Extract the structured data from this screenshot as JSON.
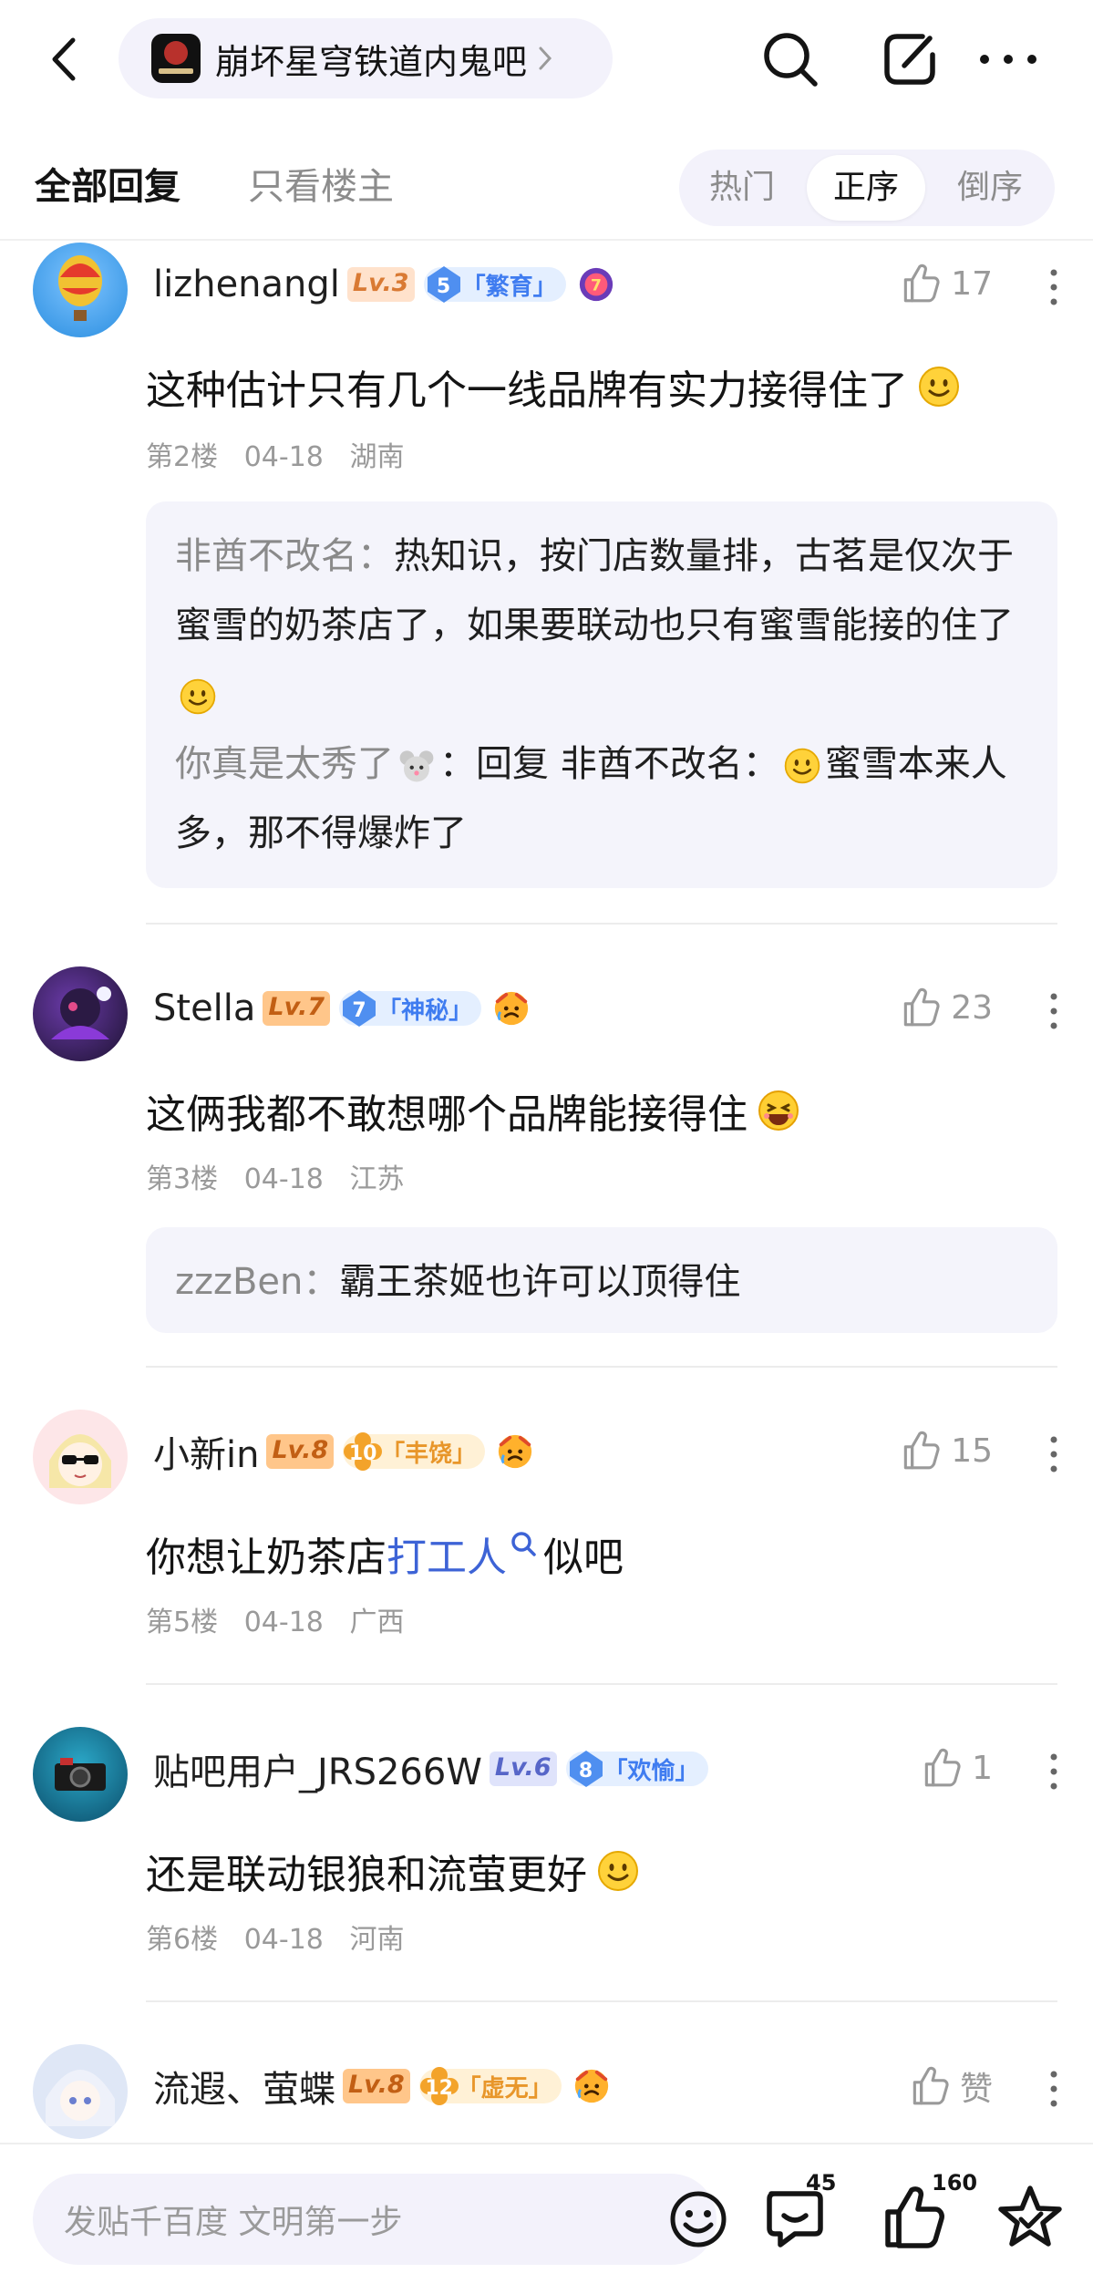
{
  "header": {
    "forum_name": "崩坏星穹铁道内鬼吧"
  },
  "tabs": {
    "all": "全部回复",
    "op_only": "只看楼主",
    "sort": {
      "hot": "热门",
      "asc": "正序",
      "desc": "倒序",
      "selected": "正序"
    }
  },
  "posts": [
    {
      "username": "lizhenangl",
      "level": "Lv.3",
      "tier_num": "5",
      "tier_label": "「繁育」",
      "likes": "17",
      "content": "这种估计只有几个一线品牌有实力接得住了",
      "floor": "第2楼",
      "date": "04-18",
      "location": "湖南",
      "replies": [
        {
          "name": "非酋不改名：",
          "text": "热知识，按门店数量排，古茗是仅次于蜜雪的奶茶店了，如果要联动也只有蜜雪能接的住了"
        },
        {
          "name": "你真是太秀了",
          "text_prefix": "：回复 非酋不改名：",
          "text": "蜜雪本来人多，那不得爆炸了"
        }
      ]
    },
    {
      "username": "Stella",
      "level": "Lv.7",
      "tier_num": "7",
      "tier_label": "「神秘」",
      "likes": "23",
      "content": "这俩我都不敢想哪个品牌能接得住",
      "floor": "第3楼",
      "date": "04-18",
      "location": "江苏",
      "replies": [
        {
          "name": "zzzBen：",
          "text": "霸王茶姬也许可以顶得住"
        }
      ]
    },
    {
      "username": "小新in",
      "level": "Lv.8",
      "tier_num": "10",
      "tier_label": "「丰饶」",
      "likes": "15",
      "content_before": "你想让奶茶店",
      "content_link": "打工人",
      "content_after": "似吧",
      "floor": "第5楼",
      "date": "04-18",
      "location": "广西"
    },
    {
      "username": "贴吧用户_JRS266W",
      "level": "Lv.6",
      "tier_num": "8",
      "tier_label": "「欢愉」",
      "likes": "1",
      "content": "还是联动银狼和流萤更好",
      "floor": "第6楼",
      "date": "04-18",
      "location": "河南"
    },
    {
      "username": "流遐、萤蝶",
      "level": "Lv.8",
      "tier_num": "12",
      "tier_label": "「虚无」",
      "likes": "赞"
    }
  ],
  "bottom": {
    "input_placeholder": "发贴千百度 文明第一步",
    "comment_count": "45",
    "like_count": "160"
  },
  "icons": {
    "back": "back-arrow-icon",
    "search": "search-icon",
    "share": "share-icon",
    "more": "more-icon",
    "like": "thumbs-up-icon",
    "emoji": "smiley-icon",
    "comment": "comment-icon",
    "favorite": "star-icon"
  },
  "colors": {
    "accent_link": "#3d63d6",
    "pill_bg": "#f3f2fb",
    "reply_bg": "#f4f4fb"
  }
}
